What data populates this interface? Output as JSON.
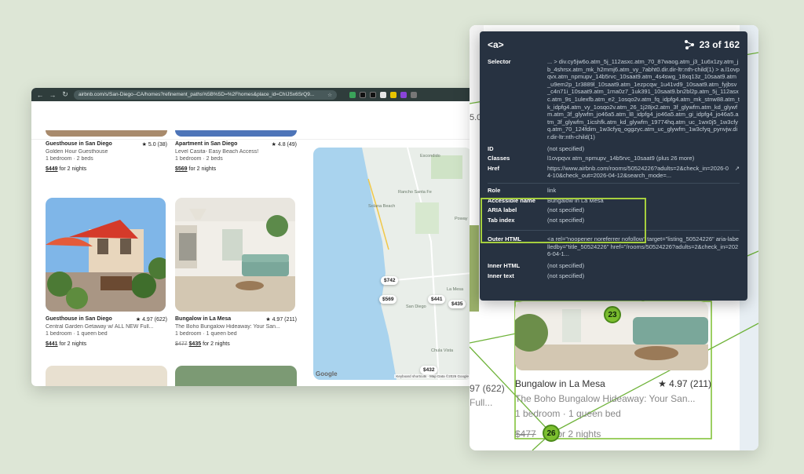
{
  "browser": {
    "nav": {
      "back": "←",
      "forward": "→",
      "reload": "↻"
    },
    "url": "airbnb.com/s/San-Diego--CA/homes?refinement_paths%5B%5D=%2Fhomes&place_id=ChIJSx6SrQ9...",
    "star": "☆"
  },
  "listings": [
    {
      "title": "Guesthouse in San Diego",
      "rating": "★ 5.0 (38)",
      "desc": "Golden Hour Guesthouse",
      "beds": "1 bedroom · 2 beds",
      "price": "$449",
      "price_suffix": "for 2 nights"
    },
    {
      "title": "Apartment in San Diego",
      "rating": "★ 4.8 (49)",
      "desc": "Level Casita- Easy Beach Access!",
      "beds": "1 bedroom · 2 beds",
      "price": "$569",
      "price_suffix": "for 2 nights"
    },
    {
      "title": "Guesthouse in San Diego",
      "rating": "★ 4.97 (622)",
      "desc": "Central Garden Getaway w/ ALL NEW Full...",
      "beds": "1 bedroom · 1 queen bed",
      "price": "$441",
      "price_suffix": "for 2 nights"
    },
    {
      "title": "Bungalow in La Mesa",
      "rating": "★ 4.97 (211)",
      "desc": "The Boho Bungalow Hideaway: Your San...",
      "beds": "1 bedroom · 1 queen bed",
      "old_price": "$477",
      "price": "$435",
      "price_suffix": "for 2 nights"
    }
  ],
  "map": {
    "labels": [
      "Escondido",
      "Rancho Santa Fe",
      "Solana Beach",
      "Poway",
      "La Mesa",
      "San Diego",
      "Chula Vista"
    ],
    "pins": [
      "$742",
      "$569",
      "$441",
      "$435",
      "$432"
    ],
    "google": "Google",
    "footer": "Keyboard shortcuts · Map Data ©2026 Google"
  },
  "zoom": {
    "title": "Bungalow in La Mesa",
    "rating": "★ 4.97 (211)",
    "desc": "The Boho Bungalow Hideaway: Your San...",
    "beds": "1 bedroom · 1 queen bed",
    "old_price": "$477",
    "price_suffix": "for 2 nights",
    "left_rating": "97 (622)",
    "left_desc": "Full...",
    "marker_23": "23",
    "marker_26": "26",
    "side_text": "5.0"
  },
  "inspector": {
    "tag": "<a>",
    "count": "23 of 162",
    "selector_label": "Selector",
    "selector": "... > div.cy5jw6o.atm_5j_112asxc.atm_70_87waog.atm_j3_1u6x1zy.atm_jb_4shrsx.atm_mk_h2mmj6.atm_vy_7abht0.dir.dir-ltr:nth-child(1) > a.l1ovpqvx.atm_npmupv_14b5rvc_10saat9.atm_4s4swg_18xq13z_10saat9.atm_u9em2p_1r3889l_10saat9.atm_1ezpcqw_1u41vd9_10saat9.atm_fyjbsv_c4n71i_10saat9.atm_1rna0z7_1uk391_10saat9.bn2bl2p.atm_5j_112asxc.atm_9s_1ulexfb.atm_e2_1osqo2v.atm_fq_idpfg4.atm_mk_stnw88.atm_tk_idpfg4.atm_vy_1osqo2v.atm_26_1j28jx2.atm_3f_glywfm.atm_kd_glywfm.atm_3f_glywfm_jo46a5.atm_l8_idpfg4_jo46a5.atm_gi_idpfg4_jo46a5.atm_3f_glywfm_1icshfk.atm_kd_glywfm_19774hq.atm_uc_1wx0j5_1w3cfyq.atm_70_124fdim_1w3cfyq_oggzyc.atm_uc_glywfm_1w3cfyq_pynvjw.dir.dir-ltr:nth-child(1)",
    "id_label": "ID",
    "id": "(not specified)",
    "classes_label": "Classes",
    "classes": "l1ovpqvx atm_npmupv_14b5rvc_10saat9 (plus 26 more)",
    "href_label": "Href",
    "href": "https://www.airbnb.com/rooms/50524226?adults=2&check_in=2026-04-10&check_out=2026-04-12&search_mode=...",
    "role_label": "Role",
    "role": "link",
    "accname_label": "Accessible name",
    "accname": "Bungalow in La Mesa",
    "aria_label": "ARIA label",
    "aria": "(not specified)",
    "tab_label": "Tab index",
    "tab": "(not specified)",
    "outer_label": "Outer HTML",
    "outer": "<a rel=\"noopener noreferrer nofollow\" target=\"listing_50524226\" aria-labelledby=\"title_50524226\" href=\"/rooms/50524226?adults=2&check_in=2026-04-1...",
    "inner_html_label": "Inner HTML",
    "inner_html": "(not specified)",
    "inner_text_label": "Inner text",
    "inner_text": "(not specified)"
  }
}
